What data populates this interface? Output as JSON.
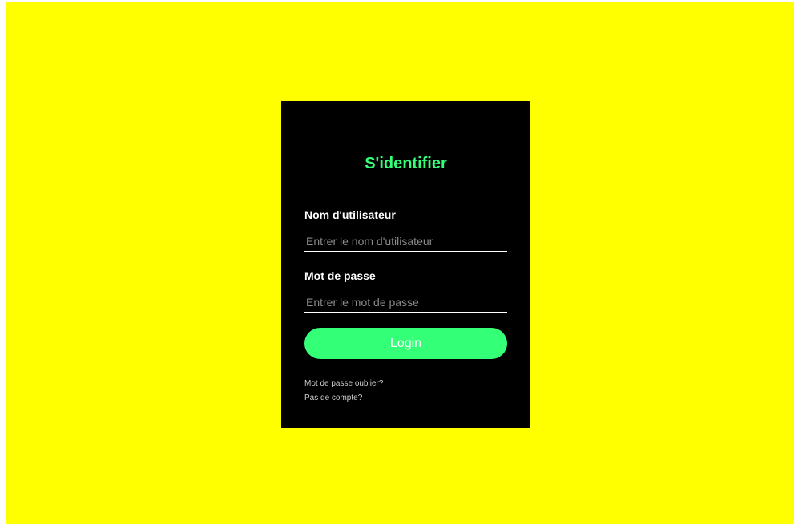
{
  "colors": {
    "background": "#ffff00",
    "card": "#000000",
    "accent": "#33ff77",
    "text": "#ffffff"
  },
  "login": {
    "title": "S'identifier",
    "username": {
      "label": "Nom d'utilisateur",
      "value": "",
      "placeholder": "Entrer le nom d'utilisateur"
    },
    "password": {
      "label": "Mot de passe",
      "value": "",
      "placeholder": "Entrer le mot de passe"
    },
    "submit_label": "Login",
    "links": {
      "forgot_password": "Mot de passe oublier?",
      "no_account": "Pas de compte?"
    }
  }
}
